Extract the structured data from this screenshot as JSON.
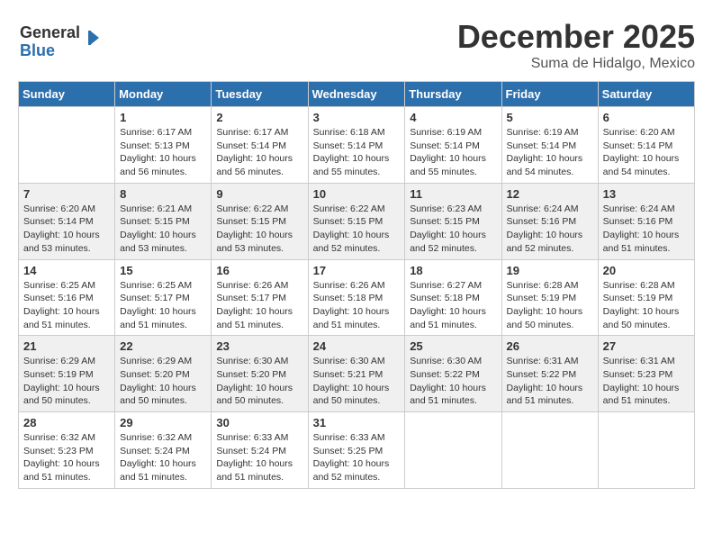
{
  "logo": {
    "general": "General",
    "blue": "Blue"
  },
  "header": {
    "month": "December 2025",
    "location": "Suma de Hidalgo, Mexico"
  },
  "days_of_week": [
    "Sunday",
    "Monday",
    "Tuesday",
    "Wednesday",
    "Thursday",
    "Friday",
    "Saturday"
  ],
  "weeks": [
    [
      {
        "day": "",
        "info": ""
      },
      {
        "day": "1",
        "info": "Sunrise: 6:17 AM\nSunset: 5:13 PM\nDaylight: 10 hours\nand 56 minutes."
      },
      {
        "day": "2",
        "info": "Sunrise: 6:17 AM\nSunset: 5:14 PM\nDaylight: 10 hours\nand 56 minutes."
      },
      {
        "day": "3",
        "info": "Sunrise: 6:18 AM\nSunset: 5:14 PM\nDaylight: 10 hours\nand 55 minutes."
      },
      {
        "day": "4",
        "info": "Sunrise: 6:19 AM\nSunset: 5:14 PM\nDaylight: 10 hours\nand 55 minutes."
      },
      {
        "day": "5",
        "info": "Sunrise: 6:19 AM\nSunset: 5:14 PM\nDaylight: 10 hours\nand 54 minutes."
      },
      {
        "day": "6",
        "info": "Sunrise: 6:20 AM\nSunset: 5:14 PM\nDaylight: 10 hours\nand 54 minutes."
      }
    ],
    [
      {
        "day": "7",
        "info": "Sunrise: 6:20 AM\nSunset: 5:14 PM\nDaylight: 10 hours\nand 53 minutes."
      },
      {
        "day": "8",
        "info": "Sunrise: 6:21 AM\nSunset: 5:15 PM\nDaylight: 10 hours\nand 53 minutes."
      },
      {
        "day": "9",
        "info": "Sunrise: 6:22 AM\nSunset: 5:15 PM\nDaylight: 10 hours\nand 53 minutes."
      },
      {
        "day": "10",
        "info": "Sunrise: 6:22 AM\nSunset: 5:15 PM\nDaylight: 10 hours\nand 52 minutes."
      },
      {
        "day": "11",
        "info": "Sunrise: 6:23 AM\nSunset: 5:15 PM\nDaylight: 10 hours\nand 52 minutes."
      },
      {
        "day": "12",
        "info": "Sunrise: 6:24 AM\nSunset: 5:16 PM\nDaylight: 10 hours\nand 52 minutes."
      },
      {
        "day": "13",
        "info": "Sunrise: 6:24 AM\nSunset: 5:16 PM\nDaylight: 10 hours\nand 51 minutes."
      }
    ],
    [
      {
        "day": "14",
        "info": "Sunrise: 6:25 AM\nSunset: 5:16 PM\nDaylight: 10 hours\nand 51 minutes."
      },
      {
        "day": "15",
        "info": "Sunrise: 6:25 AM\nSunset: 5:17 PM\nDaylight: 10 hours\nand 51 minutes."
      },
      {
        "day": "16",
        "info": "Sunrise: 6:26 AM\nSunset: 5:17 PM\nDaylight: 10 hours\nand 51 minutes."
      },
      {
        "day": "17",
        "info": "Sunrise: 6:26 AM\nSunset: 5:18 PM\nDaylight: 10 hours\nand 51 minutes."
      },
      {
        "day": "18",
        "info": "Sunrise: 6:27 AM\nSunset: 5:18 PM\nDaylight: 10 hours\nand 51 minutes."
      },
      {
        "day": "19",
        "info": "Sunrise: 6:28 AM\nSunset: 5:19 PM\nDaylight: 10 hours\nand 50 minutes."
      },
      {
        "day": "20",
        "info": "Sunrise: 6:28 AM\nSunset: 5:19 PM\nDaylight: 10 hours\nand 50 minutes."
      }
    ],
    [
      {
        "day": "21",
        "info": "Sunrise: 6:29 AM\nSunset: 5:19 PM\nDaylight: 10 hours\nand 50 minutes."
      },
      {
        "day": "22",
        "info": "Sunrise: 6:29 AM\nSunset: 5:20 PM\nDaylight: 10 hours\nand 50 minutes."
      },
      {
        "day": "23",
        "info": "Sunrise: 6:30 AM\nSunset: 5:20 PM\nDaylight: 10 hours\nand 50 minutes."
      },
      {
        "day": "24",
        "info": "Sunrise: 6:30 AM\nSunset: 5:21 PM\nDaylight: 10 hours\nand 50 minutes."
      },
      {
        "day": "25",
        "info": "Sunrise: 6:30 AM\nSunset: 5:22 PM\nDaylight: 10 hours\nand 51 minutes."
      },
      {
        "day": "26",
        "info": "Sunrise: 6:31 AM\nSunset: 5:22 PM\nDaylight: 10 hours\nand 51 minutes."
      },
      {
        "day": "27",
        "info": "Sunrise: 6:31 AM\nSunset: 5:23 PM\nDaylight: 10 hours\nand 51 minutes."
      }
    ],
    [
      {
        "day": "28",
        "info": "Sunrise: 6:32 AM\nSunset: 5:23 PM\nDaylight: 10 hours\nand 51 minutes."
      },
      {
        "day": "29",
        "info": "Sunrise: 6:32 AM\nSunset: 5:24 PM\nDaylight: 10 hours\nand 51 minutes."
      },
      {
        "day": "30",
        "info": "Sunrise: 6:33 AM\nSunset: 5:24 PM\nDaylight: 10 hours\nand 51 minutes."
      },
      {
        "day": "31",
        "info": "Sunrise: 6:33 AM\nSunset: 5:25 PM\nDaylight: 10 hours\nand 52 minutes."
      },
      {
        "day": "",
        "info": ""
      },
      {
        "day": "",
        "info": ""
      },
      {
        "day": "",
        "info": ""
      }
    ]
  ]
}
